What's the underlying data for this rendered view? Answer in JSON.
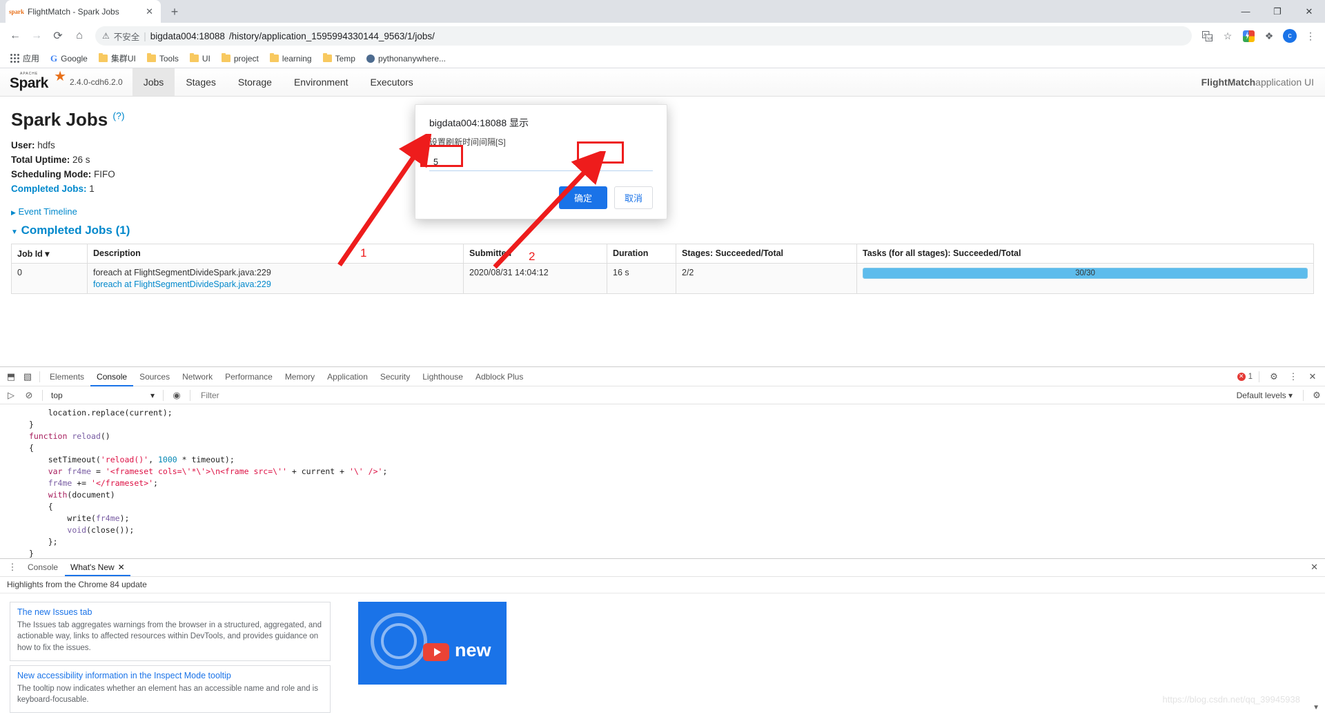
{
  "browser": {
    "tab": {
      "title": "FlightMatch - Spark Jobs",
      "favicon": "spark-favicon",
      "close": "✕"
    },
    "new_tab_label": "+",
    "window_controls": {
      "minimize": "—",
      "maximize": "❐",
      "close": "✕"
    },
    "nav": {
      "back": "←",
      "forward": "→",
      "reload": "⟳",
      "home": "⌂"
    },
    "omnibox": {
      "warning_icon": "⚠",
      "security_text": "不安全",
      "separator": "|",
      "url_host": "bigdata004:18088",
      "url_path": "/history/application_1595994330144_9563/1/jobs/"
    },
    "omnibox_icons": {
      "translate": "translate-icon",
      "bookmark_star": "☆",
      "extension_puzzle": "❖",
      "profile_letter": "c",
      "menu_dots": "⋮"
    },
    "bookmarks": [
      {
        "label": "应用",
        "icon": "apps-grid-icon"
      },
      {
        "label": "Google",
        "icon": "google-g-icon"
      },
      {
        "label": "集群UI",
        "icon": "folder-icon"
      },
      {
        "label": "Tools",
        "icon": "folder-icon"
      },
      {
        "label": "UI",
        "icon": "folder-icon"
      },
      {
        "label": "project",
        "icon": "folder-icon"
      },
      {
        "label": "learning",
        "icon": "folder-icon"
      },
      {
        "label": "Temp",
        "icon": "folder-icon"
      },
      {
        "label": "pythonanywhere...",
        "icon": "globe-icon"
      }
    ]
  },
  "spark": {
    "logo_word": "Spark",
    "logo_apache": "APACHE",
    "version": "2.4.0-cdh6.2.0",
    "tabs": [
      {
        "label": "Jobs",
        "active": true
      },
      {
        "label": "Stages",
        "active": false
      },
      {
        "label": "Storage",
        "active": false
      },
      {
        "label": "Environment",
        "active": false
      },
      {
        "label": "Executors",
        "active": false
      }
    ],
    "app_name_bold": "FlightMatch",
    "app_name_rest": " application UI",
    "page_title": "Spark Jobs",
    "page_title_help": "(?)",
    "summary": [
      {
        "key": "User:",
        "value": "hdfs",
        "link": false
      },
      {
        "key": "Total Uptime:",
        "value": "26 s",
        "link": false
      },
      {
        "key": "Scheduling Mode:",
        "value": "FIFO",
        "link": false
      },
      {
        "key": "Completed Jobs:",
        "value": "1",
        "link": true
      }
    ],
    "event_timeline": "Event Timeline",
    "completed_header": "Completed Jobs (1)",
    "table": {
      "headers": [
        "Job Id",
        "Description",
        "Submitted",
        "Duration",
        "Stages: Succeeded/Total",
        "Tasks (for all stages): Succeeded/Total"
      ],
      "sort_caret": "▾",
      "rows": [
        {
          "job_id": "0",
          "description_plain": "foreach at FlightSegmentDivideSpark.java:229",
          "description_link": "foreach at FlightSegmentDivideSpark.java:229",
          "submitted": "2020/08/31 14:04:12",
          "duration": "16 s",
          "stages": "2/2",
          "tasks_text": "30/30",
          "tasks_percent": 100
        }
      ]
    }
  },
  "dialog": {
    "title": "bigdata004:18088 显示",
    "message": "设置刷新时间间隔[S]",
    "input_value": "5",
    "ok_label": "确定",
    "cancel_label": "取消"
  },
  "annotations": {
    "marker_1": "1",
    "marker_2": "2",
    "color": "#ee1c1c"
  },
  "devtools": {
    "tabs": [
      {
        "label": "Elements",
        "active": false
      },
      {
        "label": "Console",
        "active": true
      },
      {
        "label": "Sources",
        "active": false
      },
      {
        "label": "Network",
        "active": false
      },
      {
        "label": "Performance",
        "active": false
      },
      {
        "label": "Memory",
        "active": false
      },
      {
        "label": "Application",
        "active": false
      },
      {
        "label": "Security",
        "active": false
      },
      {
        "label": "Lighthouse",
        "active": false
      },
      {
        "label": "Adblock Plus",
        "active": false
      }
    ],
    "inspect_icon": "⬒",
    "device_icon": "▧",
    "error_count": "1",
    "settings_icon": "⚙",
    "more_icon": "⋮",
    "close_icon": "✕",
    "console_toolbar": {
      "execute_icon": "▷",
      "clear_icon": "⊘",
      "context": "top",
      "context_caret": "▾",
      "eye_icon": "◉",
      "filter_placeholder": "Filter",
      "levels": "Default levels ▾"
    },
    "console_code": [
      "    location.replace(current);",
      "}",
      "",
      "function reload()",
      "{",
      "    setTimeout('reload()', 1000 * timeout);",
      "    var fr4me = '<frameset cols=\\'*\\'>\\n<frame src=\\'' + current + '\\' />';",
      "    fr4me += '</frameset>';",
      "",
      "    with(document)",
      "    {",
      "        write(fr4me);",
      "        void(close());",
      "    };",
      "}"
    ],
    "prompt_symbol": "›",
    "drawer": {
      "menu_icon": "⋮",
      "tabs": [
        {
          "label": "Console",
          "active": false,
          "closable": false
        },
        {
          "label": "What's New",
          "active": true,
          "closable": true
        }
      ],
      "tab_close": "✕",
      "close_icon": "✕",
      "subtitle": "Highlights from the Chrome 84 update",
      "cards": [
        {
          "title": "The new Issues tab",
          "body": "The Issues tab aggregates warnings from the browser in a structured, aggregated, and actionable way, links to affected resources within DevTools, and provides guidance on how to fix the issues."
        },
        {
          "title": "New accessibility information in the Inspect Mode tooltip",
          "body": "The tooltip now indicates whether an element has an accessible name and role and is keyboard-focusable."
        }
      ],
      "video_text": "new"
    }
  },
  "watermark": "https://blog.csdn.net/qq_39945938"
}
